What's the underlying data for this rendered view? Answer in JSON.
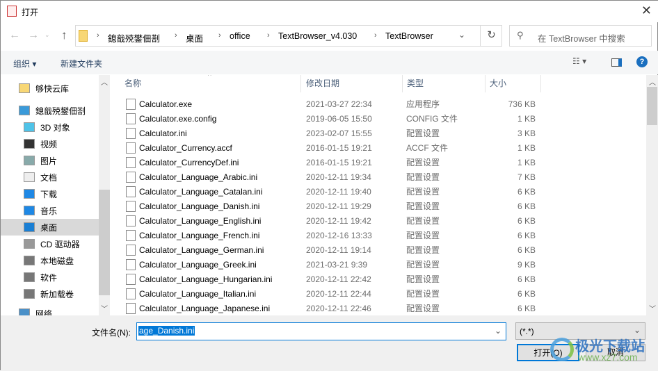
{
  "window": {
    "title": "打开"
  },
  "nav": {
    "back": "←",
    "forward": "→",
    "up": "↑",
    "refresh": "↻"
  },
  "address": {
    "crumbs": [
      "鎴戠殑鐢佃剳",
      "桌面",
      "office",
      "TextBrowser_v4.030",
      "TextBrowser"
    ]
  },
  "search": {
    "placeholder": "在 TextBrowser 中搜索"
  },
  "toolbar": {
    "organize": "组织 ▾",
    "new_folder": "新建文件夹"
  },
  "sidebar": {
    "items": [
      {
        "label": "够快云库",
        "icon": "folder-icon"
      },
      {
        "label": "鎴戠殑鐢佃剳",
        "icon": "computer-icon"
      },
      {
        "label": "3D 对象",
        "icon": "cube-icon"
      },
      {
        "label": "视频",
        "icon": "video-icon"
      },
      {
        "label": "图片",
        "icon": "picture-icon"
      },
      {
        "label": "文档",
        "icon": "document-icon"
      },
      {
        "label": "下载",
        "icon": "download-icon"
      },
      {
        "label": "音乐",
        "icon": "music-icon"
      },
      {
        "label": "桌面",
        "icon": "desktop-icon",
        "selected": true
      },
      {
        "label": "CD 驱动器",
        "icon": "cd-drive-icon"
      },
      {
        "label": "本地磁盘",
        "icon": "disk-icon"
      },
      {
        "label": "软件",
        "icon": "disk-icon"
      },
      {
        "label": "新加载卷",
        "icon": "disk-icon"
      },
      {
        "label": "网络",
        "icon": "network-icon"
      }
    ]
  },
  "columns": {
    "name": "名称",
    "date": "修改日期",
    "type": "类型",
    "size": "大小"
  },
  "files": [
    {
      "name": "Calculator.exe",
      "date": "2021-03-27 22:34",
      "type": "应用程序",
      "size": "736 KB"
    },
    {
      "name": "Calculator.exe.config",
      "date": "2019-06-05 15:50",
      "type": "CONFIG 文件",
      "size": "1 KB"
    },
    {
      "name": "Calculator.ini",
      "date": "2023-02-07 15:55",
      "type": "配置设置",
      "size": "3 KB"
    },
    {
      "name": "Calculator_Currency.accf",
      "date": "2016-01-15 19:21",
      "type": "ACCF 文件",
      "size": "1 KB"
    },
    {
      "name": "Calculator_CurrencyDef.ini",
      "date": "2016-01-15 19:21",
      "type": "配置设置",
      "size": "1 KB"
    },
    {
      "name": "Calculator_Language_Arabic.ini",
      "date": "2020-12-11 19:34",
      "type": "配置设置",
      "size": "7 KB"
    },
    {
      "name": "Calculator_Language_Catalan.ini",
      "date": "2020-12-11 19:40",
      "type": "配置设置",
      "size": "6 KB"
    },
    {
      "name": "Calculator_Language_Danish.ini",
      "date": "2020-12-11 19:29",
      "type": "配置设置",
      "size": "6 KB"
    },
    {
      "name": "Calculator_Language_English.ini",
      "date": "2020-12-11 19:42",
      "type": "配置设置",
      "size": "6 KB"
    },
    {
      "name": "Calculator_Language_French.ini",
      "date": "2020-12-16 13:33",
      "type": "配置设置",
      "size": "6 KB"
    },
    {
      "name": "Calculator_Language_German.ini",
      "date": "2020-12-11 19:14",
      "type": "配置设置",
      "size": "6 KB"
    },
    {
      "name": "Calculator_Language_Greek.ini",
      "date": "2021-03-21 9:39",
      "type": "配置设置",
      "size": "9 KB"
    },
    {
      "name": "Calculator_Language_Hungarian.ini",
      "date": "2020-12-11 22:42",
      "type": "配置设置",
      "size": "6 KB"
    },
    {
      "name": "Calculator_Language_Italian.ini",
      "date": "2020-12-11 22:44",
      "type": "配置设置",
      "size": "6 KB"
    },
    {
      "name": "Calculator_Language_Japanese.ini",
      "date": "2020-12-11 22:46",
      "type": "配置设置",
      "size": "6 KB"
    }
  ],
  "filename": {
    "label": "文件名(N):",
    "value": "age_Danish.ini"
  },
  "filter": {
    "value": "(*.*)"
  },
  "buttons": {
    "open": "打开(O)",
    "cancel": "取消"
  },
  "watermark": {
    "text": "极光下载站",
    "url": "www.xz7.com"
  }
}
